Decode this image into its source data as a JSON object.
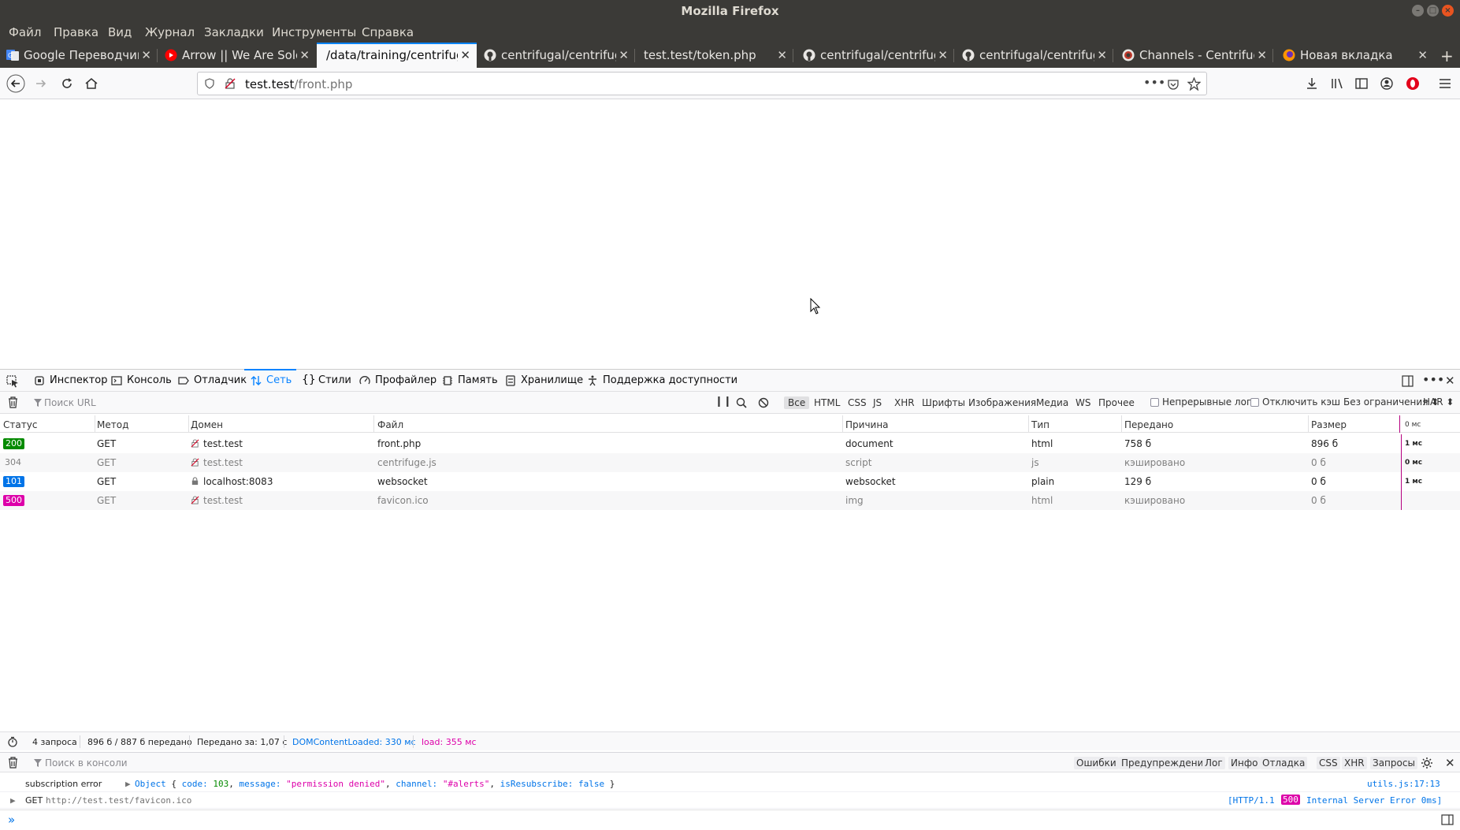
{
  "window": {
    "title": "Mozilla Firefox"
  },
  "menu": [
    "Файл",
    "Правка",
    "Вид",
    "Журнал",
    "Закладки",
    "Инструменты",
    "Справка"
  ],
  "tabs": [
    {
      "label": "Google Переводчик",
      "icon": "google-translate-icon"
    },
    {
      "label": "Arrow || We Are Soldi",
      "icon": "youtube-icon"
    },
    {
      "label": "/data/training/centrifuge",
      "icon": "none",
      "active": true
    },
    {
      "label": "centrifugal/centrifuge",
      "icon": "github-icon"
    },
    {
      "label": "test.test/token.php",
      "icon": "none"
    },
    {
      "label": "centrifugal/centrifuge",
      "icon": "github-icon"
    },
    {
      "label": "centrifugal/centrifuge",
      "icon": "github-icon"
    },
    {
      "label": "Channels - Centrifugo",
      "icon": "centrifugo-icon"
    },
    {
      "label": "Новая вкладка",
      "icon": "firefox-icon"
    }
  ],
  "url": {
    "host": "test.test",
    "path": "/front.php"
  },
  "devtools": {
    "tabs": [
      "Инспектор",
      "Консоль",
      "Отладчик",
      "Сеть",
      "Стили",
      "Профайлер",
      "Память",
      "Хранилище",
      "Поддержка доступности"
    ],
    "active_tab": "Сеть"
  },
  "network": {
    "filter_placeholder": "Поиск URL",
    "types": [
      "Все",
      "HTML",
      "CSS",
      "JS",
      "XHR",
      "Шрифты",
      "Изображения",
      "Медиа",
      "WS",
      "Прочее"
    ],
    "persist_logs": "Непрерывные логи",
    "disable_cache": "Отключить кэш",
    "throttling": "Без ограничения ⬍",
    "har": "HAR ⬍",
    "columns": [
      "Статус",
      "Метод",
      "Домен",
      "Файл",
      "Причина",
      "Тип",
      "Передано",
      "Размер",
      "0 мс"
    ],
    "rows": [
      {
        "status": "200",
        "color": "#058b00",
        "method": "GET",
        "domain": "test.test",
        "file": "front.php",
        "cause": "document",
        "type": "html",
        "transferred": "758 б",
        "size": "896 б",
        "time": "1 мс",
        "dim": false,
        "secure": false
      },
      {
        "status": "304",
        "color": "",
        "method": "GET",
        "domain": "test.test",
        "file": "centrifuge.js",
        "cause": "script",
        "type": "js",
        "transferred": "кэшировано",
        "size": "0 б",
        "time": "0 мс",
        "dim": true,
        "secure": false
      },
      {
        "status": "101",
        "color": "#0074e8",
        "method": "GET",
        "domain": "localhost:8083",
        "file": "websocket",
        "cause": "websocket",
        "type": "plain",
        "transferred": "129 б",
        "size": "0 б",
        "time": "1 мс",
        "dim": false,
        "secure": true
      },
      {
        "status": "500",
        "color": "#dd00a9",
        "method": "GET",
        "domain": "test.test",
        "file": "favicon.ico",
        "cause": "img",
        "type": "html",
        "transferred": "кэшировано",
        "size": "0 б",
        "time": "",
        "dim": true,
        "secure": false
      }
    ],
    "summary": {
      "requests": "4 запроса",
      "transferred": "896 б / 887 б передано",
      "finish": "Передано за: 1,07 с",
      "dcl": "DOMContentLoaded: 330 мс",
      "load": "load: 355 мс"
    }
  },
  "console": {
    "filter_placeholder": "Поиск в консоли",
    "filters": [
      "Ошибки",
      "Предупреждения",
      "Лог",
      "Инфо",
      "Отладка",
      "CSS",
      "XHR",
      "Запросы"
    ],
    "line1": {
      "label": "subscription error",
      "obj": "Object",
      "open": "{ ",
      "k1": "code:",
      "v1": "103",
      "c1": ", ",
      "k2": "message:",
      "v2": "\"permission denied\"",
      "c2": ", ",
      "k3": "channel:",
      "v3": "\"#alerts\"",
      "c3": ", ",
      "k4": "isResubscribe:",
      "v4": "false",
      "close": " }",
      "source": "utils.js:17:13"
    },
    "line2": {
      "method": "GET",
      "url": "http://test.test/favicon.ico",
      "proto": "[HTTP/1.1",
      "code": "500",
      "text": "Internal Server Error 0ms]"
    }
  }
}
